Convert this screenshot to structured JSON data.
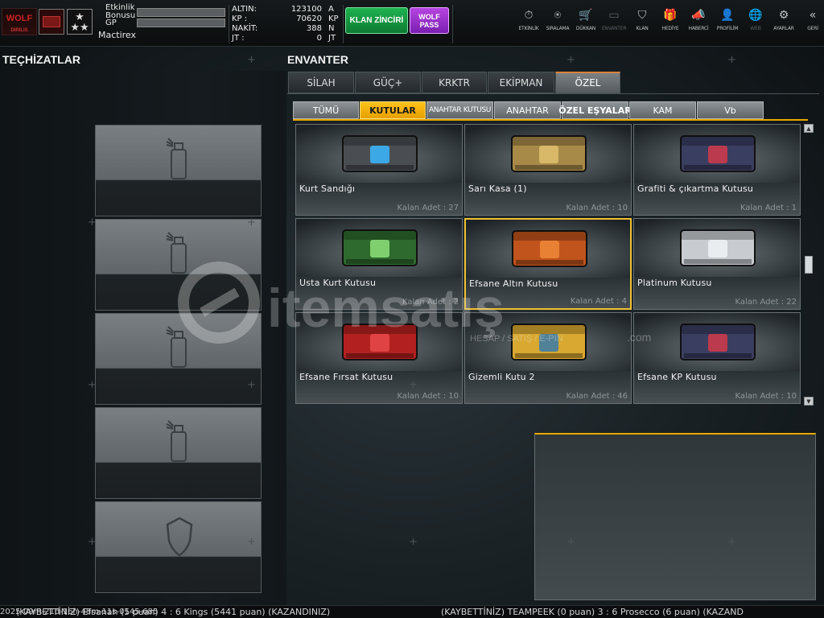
{
  "topbar": {
    "logo_text": "WOLF",
    "logo_sub": "DIRILIS",
    "event_bonus_label": "Etkinlik Bonusu",
    "gp_label": "GP",
    "username": "Mactirex",
    "currencies": [
      {
        "label": "ALTIN:",
        "value": "123100",
        "unit": "A"
      },
      {
        "label": "KP :",
        "value": "70620",
        "unit": "KP"
      },
      {
        "label": "NAKİT:",
        "value": "388",
        "unit": "N"
      },
      {
        "label": "JT :",
        "value": "0",
        "unit": "JT"
      }
    ],
    "klan_button": "KLAN ZİNCİRİ",
    "wolf_pass_button": "WOLF PASS",
    "nav": [
      {
        "label": "ETKİNLİK",
        "icon": "stopwatch-icon",
        "glyph": "⏱",
        "enabled": true
      },
      {
        "label": "SIRALAMA",
        "icon": "medal-icon",
        "glyph": "⍟",
        "enabled": true
      },
      {
        "label": "DÜKKAN",
        "icon": "cart-icon",
        "glyph": "🛒",
        "enabled": true
      },
      {
        "label": "ENVANTER",
        "icon": "inventory-icon",
        "glyph": "▭",
        "enabled": false
      },
      {
        "label": "KLAN",
        "icon": "clan-shield-icon",
        "glyph": "⛉",
        "enabled": true
      },
      {
        "label": "HEDİYE",
        "icon": "gift-icon",
        "glyph": "🎁",
        "enabled": true
      },
      {
        "label": "HABERCİ",
        "icon": "megaphone-icon",
        "glyph": "📣",
        "enabled": true
      },
      {
        "label": "PROFİLİM",
        "icon": "profile-icon",
        "glyph": "👤",
        "enabled": true
      },
      {
        "label": "WEB",
        "icon": "globe-icon",
        "glyph": "🌐",
        "enabled": false
      },
      {
        "label": "AYARLAR",
        "icon": "gear-icon",
        "glyph": "⚙",
        "enabled": true
      },
      {
        "label": "GERİ",
        "icon": "back-icon",
        "glyph": "«",
        "enabled": true
      }
    ]
  },
  "equipment": {
    "title": "TEÇHİZATLAR",
    "slots": [
      {
        "icon": "spray-can-icon"
      },
      {
        "icon": "spray-can-icon"
      },
      {
        "icon": "spray-can-icon"
      },
      {
        "icon": "spray-can-icon"
      },
      {
        "icon": "shield-icon"
      }
    ]
  },
  "inventory": {
    "title": "ENVANTER",
    "main_tabs": [
      {
        "label": "SİLAH",
        "active": false
      },
      {
        "label": "GÜÇ+",
        "active": false
      },
      {
        "label": "KRKTR",
        "active": false
      },
      {
        "label": "EKİPMAN",
        "active": false
      },
      {
        "label": "ÖZEL",
        "active": true
      }
    ],
    "sub_tabs": [
      {
        "label": "TÜMÜ",
        "active": false
      },
      {
        "label": "KUTULAR",
        "active": true
      },
      {
        "label": "ANAHTAR KUTUSU",
        "active": false
      },
      {
        "label": "ANAHTAR",
        "active": false
      },
      {
        "label": "ÖZEL EŞYALAR",
        "active": false
      },
      {
        "label": "KAM",
        "active": false
      },
      {
        "label": "Vb",
        "active": false
      }
    ],
    "items": [
      {
        "name": "Kurt Sandığı",
        "count": "Kalan Adet : 27",
        "color": "#4a4e52",
        "accent": "#3ab8ff",
        "selected": false
      },
      {
        "name": "Sarı Kasa (1)",
        "count": "Kalan Adet : 10",
        "color": "#a88a48",
        "accent": "#e0c070",
        "selected": false
      },
      {
        "name": "Grafiti & çıkartma Kutusu",
        "count": "Kalan Adet : 1",
        "color": "#3a3e60",
        "accent": "#d33a4a",
        "selected": false
      },
      {
        "name": "Usta Kurt Kutusu",
        "count": "Kalan Adet : 2",
        "color": "#2e6a2e",
        "accent": "#8ee07a",
        "selected": false
      },
      {
        "name": "Efsane Altın Kutusu",
        "count": "Kalan Adet : 4",
        "color": "#c0541c",
        "accent": "#f08a3a",
        "selected": true
      },
      {
        "name": "Platinum Kutusu",
        "count": "Kalan Adet : 22",
        "color": "#c8ccd0",
        "accent": "#f0f2f4",
        "selected": false
      },
      {
        "name": "Efsane Fırsat Kutusu",
        "count": "Kalan Adet : 10",
        "color": "#b32020",
        "accent": "#e84a4a",
        "selected": false
      },
      {
        "name": "Gizemli Kutu 2",
        "count": "Kalan Adet : 46",
        "color": "#d8a830",
        "accent": "#3a7aa8",
        "selected": false
      },
      {
        "name": "Efsane KP Kutusu",
        "count": "Kalan Adet : 10",
        "color": "#3a3e60",
        "accent": "#d33a4a",
        "selected": false
      }
    ],
    "scroll_up": "▲",
    "scroll_down": "▼"
  },
  "watermark": {
    "brand": "itemsatış",
    "tagline": "HESAP / SATIŞ / E-PIN",
    "suffix": ".com"
  },
  "ticker": {
    "stamp": "2025-09m-21d-16h-48m-11s-0145-685",
    "message_1": "(KAYBETTİNİZ) Efsanah (5 puan) 4 : 6 Kings (5441 puan) (KAZANDINIZ)",
    "message_2": "(KAYBETTİNİZ) TEAMPEEK (0 puan) 3 : 6 Prosecco (6 puan) (KAZAND"
  }
}
